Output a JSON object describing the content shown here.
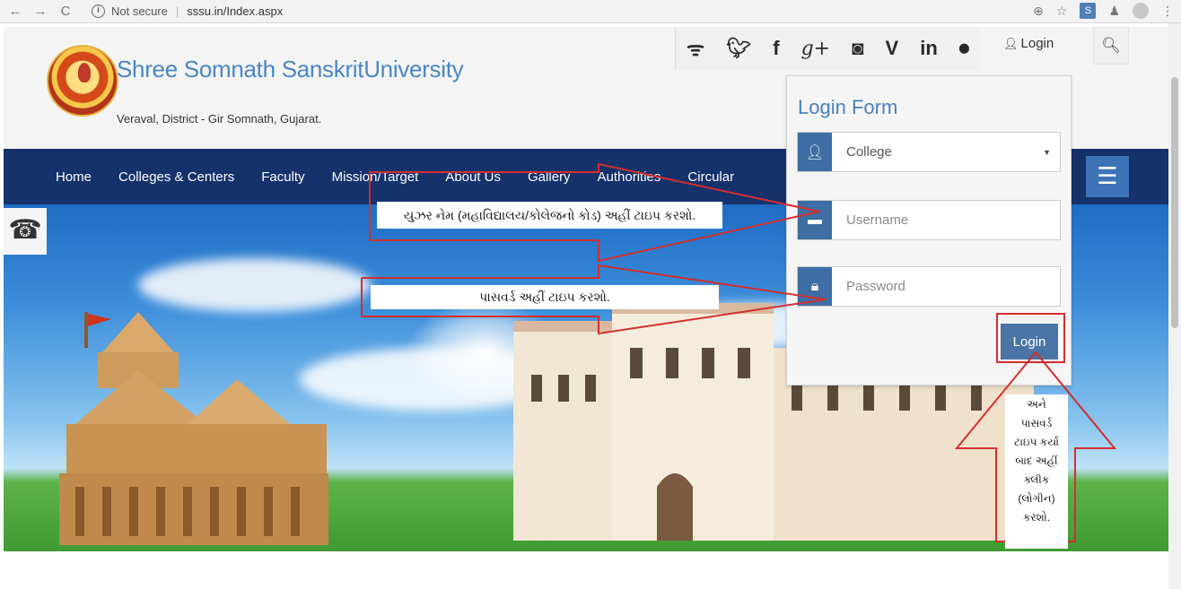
{
  "browser": {
    "back": "←",
    "forward": "→",
    "reload": "C",
    "security": "Not secure",
    "url": "sssu.in/Index.aspx"
  },
  "site": {
    "title": "Shree Somnath SanskritUniversity",
    "subtitle": "Veraval, District - Gir Somnath, Gujarat.",
    "login_label": "Login",
    "social_icons": [
      "rss-icon",
      "twitter-icon",
      "facebook-icon",
      "google-plus-icon",
      "instagram-icon",
      "vine-icon",
      "linkedin-icon",
      "flickr-icon"
    ]
  },
  "nav": {
    "items": [
      "Home",
      "Colleges & Centers",
      "Faculty",
      "Mission/Target",
      "About Us",
      "Gallery",
      "Authorities",
      "Circular"
    ]
  },
  "login_form": {
    "title": "Login Form",
    "select_value": "College",
    "username_placeholder": "Username",
    "password_placeholder": "Password",
    "submit_label": "Login"
  },
  "annotations": {
    "username_hint": "યુઝર નેમ (મહાવિદ્યાલય/કોલેજનો કોડ) અહીં ટાઇપ કરશો.",
    "password_hint": "પાસવર્ડ અહીં ટાઇપ કરશો.",
    "login_hint": [
      "અને",
      "પાસવર્ડ",
      "ટાઇપ કર્યા",
      "બાદ અહીં",
      "ક્લીક",
      "(લોગીન)",
      "કરશો."
    ],
    "accent_color": "#d32f2f"
  }
}
